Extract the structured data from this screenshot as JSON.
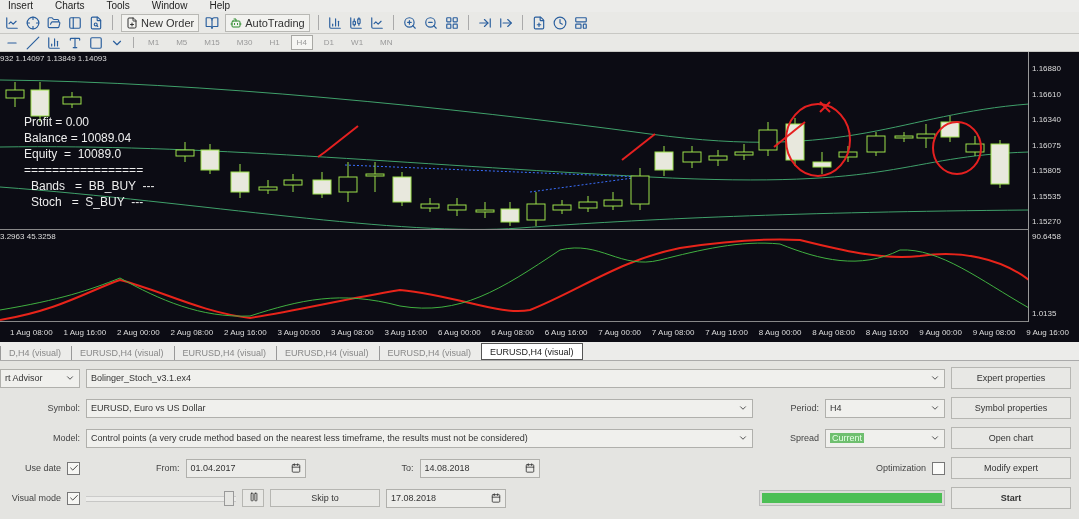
{
  "menu": [
    "Insert",
    "Charts",
    "Tools",
    "Window",
    "Help"
  ],
  "toolbar": {
    "new_order": "New Order",
    "auto_trading": "AutoTrading"
  },
  "timeframes": [
    {
      "label": "M1",
      "selected": false
    },
    {
      "label": "M5",
      "selected": false
    },
    {
      "label": "M15",
      "selected": false
    },
    {
      "label": "M30",
      "selected": false
    },
    {
      "label": "H1",
      "selected": false
    },
    {
      "label": "H4",
      "selected": true
    },
    {
      "label": "D1",
      "selected": false
    },
    {
      "label": "W1",
      "selected": false
    },
    {
      "label": "MN",
      "selected": false
    }
  ],
  "chart": {
    "ohlc_header": "932 1.14097 1.13849 1.14093",
    "info_lines": [
      "Profit = 0.00",
      "Balance = 10089.04",
      "Equity  =  10089.0"
    ],
    "separator": "=================",
    "signals": [
      "Bands   =  BB_BUY  ---",
      "Stoch   =  S_BUY  ---"
    ],
    "price_axis": [
      "1.16880",
      "1.16610",
      "1.16340",
      "1.16075",
      "1.15805",
      "1.15535",
      "1.15270"
    ],
    "indicator_header": "3.2963 45.3258",
    "indicator_axis": [
      "90.6458",
      "1.0135"
    ],
    "time_axis": [
      "1 Aug 08:00",
      "1 Aug 16:00",
      "2 Aug 00:00",
      "2 Aug 08:00",
      "2 Aug 16:00",
      "3 Aug 00:00",
      "3 Aug 08:00",
      "3 Aug 16:00",
      "6 Aug 00:00",
      "6 Aug 08:00",
      "6 Aug 16:00",
      "7 Aug 00:00",
      "7 Aug 08:00",
      "7 Aug 16:00",
      "8 Aug 00:00",
      "8 Aug 08:00",
      "8 Aug 16:00",
      "9 Aug 00:00",
      "9 Aug 08:00",
      "9 Aug 16:00"
    ]
  },
  "chart_tabs": [
    {
      "label": "D,H4 (visual)",
      "selected": false
    },
    {
      "label": "EURUSD,H4 (visual)",
      "selected": false
    },
    {
      "label": "EURUSD,H4 (visual)",
      "selected": false
    },
    {
      "label": "EURUSD,H4 (visual)",
      "selected": false
    },
    {
      "label": "EURUSD,H4 (visual)",
      "selected": false
    },
    {
      "label": "EURUSD,H4 (visual)",
      "selected": true
    }
  ],
  "tester": {
    "advisor_type": "rt Advisor",
    "expert_file": "Bolinger_Stoch_v3.1.ex4",
    "symbol": {
      "label": "Symbol:",
      "value": "EURUSD, Euro vs US Dollar"
    },
    "model": {
      "label": "Model:",
      "value": "Control points (a very crude method based on the nearest less timeframe, the results must not be considered)"
    },
    "period": {
      "label": "Period:",
      "value": "H4"
    },
    "spread": {
      "label": "Spread",
      "value": "Current"
    },
    "optimization": {
      "label": "Optimization",
      "checked": false
    },
    "use_date": {
      "label": "Use date",
      "checked": true
    },
    "from": {
      "label": "From:",
      "value": "01.04.2017"
    },
    "to": {
      "label": "To:",
      "value": "14.08.2018"
    },
    "visual_mode": {
      "label": "Visual mode",
      "checked": true,
      "level": 0.97
    },
    "skip_to": "Skip to",
    "skip_date": "17.08.2018",
    "progress": {
      "level": 1
    },
    "buttons": [
      "Expert properties",
      "Symbol properties",
      "Open chart",
      "Modify expert",
      "Start"
    ]
  }
}
